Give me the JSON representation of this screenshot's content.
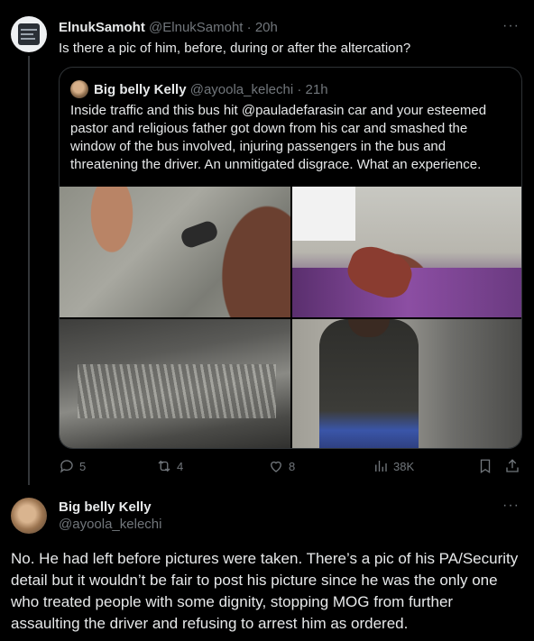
{
  "tweet1": {
    "author_name": "ElnukSamoht",
    "author_handle": "@ElnukSamoht",
    "time": "· 20h",
    "more": "···",
    "text": "Is there a pic of him, before, during or after the altercation?",
    "quoted": {
      "author_name": "Big belly Kelly",
      "author_handle": "@ayoola_kelechi",
      "time": "· 21h",
      "text_before_mention": "Inside traffic and this bus hit ",
      "mention": "@pauladefarasin",
      "text_after_mention": " car and your esteemed pastor and religious father got down from his car and smashed the window of the bus involved, injuring passengers in the bus and threatening the driver. An unmitigated disgrace. What an experience."
    },
    "actions": {
      "replies": "5",
      "reposts": "4",
      "likes": "8",
      "views": "38K"
    }
  },
  "tweet2": {
    "author_name": "Big belly Kelly",
    "author_handle": "@ayoola_kelechi",
    "more": "···",
    "text": "No. He had left before pictures were taken. There’s a pic of his PA/Security detail but it wouldn’t be fair to post his picture since he was the only one who treated people with some dignity, stopping MOG from further assaulting the driver and refusing to arrest him as ordered."
  },
  "colors": {
    "background": "#000000",
    "text": "#e7e9ea",
    "muted": "#71767b",
    "border": "#2f3336"
  },
  "icons": [
    "reply-icon",
    "repost-icon",
    "like-icon",
    "views-icon",
    "bookmark-icon",
    "share-icon",
    "more-icon"
  ]
}
